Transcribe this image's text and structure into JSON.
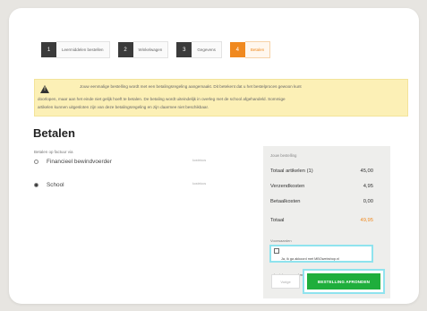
{
  "steps": [
    {
      "num": "1",
      "label": "Leermiddelen bestellen"
    },
    {
      "num": "2",
      "label": "Winkelwagen"
    },
    {
      "num": "3",
      "label": "Gegevens"
    },
    {
      "num": "4",
      "label": "Betalen"
    }
  ],
  "notice": {
    "line1": "Jouw eenmalige bestelling wordt met een betalingsregeling aangemaakt. Dit betekent dat u het bestelproces gewoon kunt",
    "line2": "doorlopen, maar aan het einde niet gelijk hoeft te betalen. De betaling wordt uiteindelijk in overleg met de school afgehandeld. Sommige",
    "line3": "artikelen kunnen uitgesloten zijn van deze betalingsregeling en zijn daarmee niet beschikbaar."
  },
  "page_title": "Betalen",
  "payment": {
    "label": "Betalen op factuur via",
    "options": [
      {
        "label": "Financieel bewindvoerder",
        "tag": "kosteloos",
        "selected": false
      },
      {
        "label": "School",
        "tag": "kosteloos",
        "selected": true
      }
    ]
  },
  "summary": {
    "title": "Jouw bestelling",
    "rows": [
      {
        "label": "Totaal artikelen (1)",
        "value": "45,00"
      },
      {
        "label": "Verzendkosten",
        "value": "4,95"
      },
      {
        "label": "Betaalkosten",
        "value": "0,00"
      }
    ],
    "total_label": "Totaal",
    "total_value": "49,95",
    "terms_label": "Voorwaarden",
    "consent_text": "Ja, ik ga akkoord met MBOwebshop.nl bestelvoorwaarden",
    "back_label": "Vorige",
    "order_label": "BESTELLING AFRONDEN",
    "accent_color": "#f0891f",
    "button_color": "#1fae3c"
  }
}
